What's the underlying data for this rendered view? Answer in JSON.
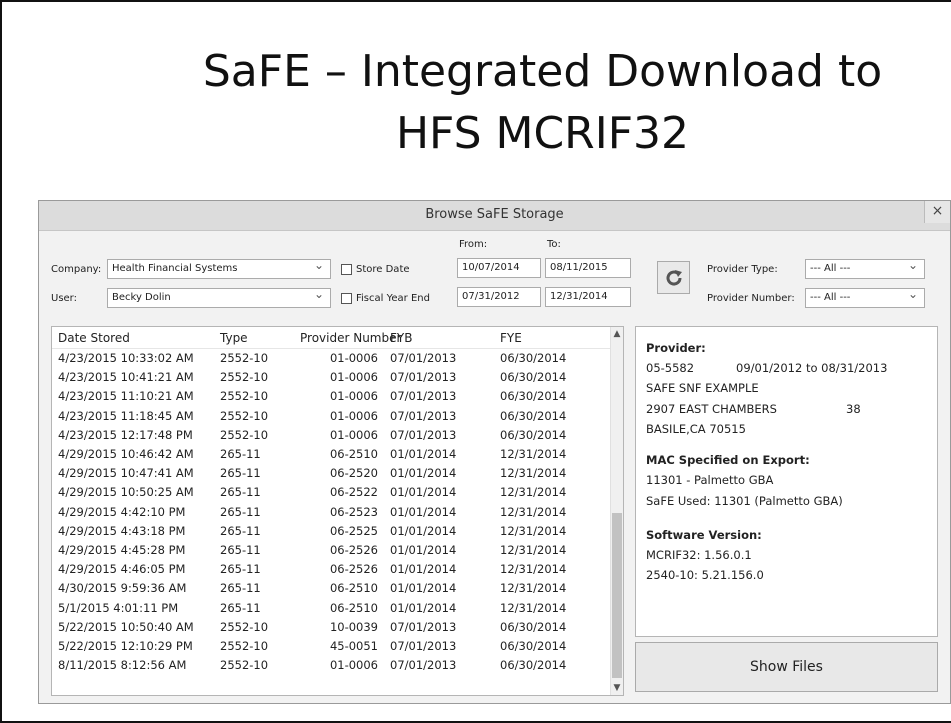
{
  "slide": {
    "title_line1": "SaFE – Integrated Download to",
    "title_line2": "HFS MCRIF32"
  },
  "window": {
    "title": "Browse SaFE Storage",
    "close_glyph": "×"
  },
  "filters": {
    "company_label": "Company:",
    "company_value": "Health Financial Systems",
    "user_label": "User:",
    "user_value": "Becky Dolin",
    "store_date_label": "Store Date",
    "fiscal_year_end_label": "Fiscal Year End",
    "from_label": "From:",
    "to_label": "To:",
    "store_from": "10/07/2014",
    "store_to": "08/11/2015",
    "fiscal_from": "07/31/2012",
    "fiscal_to": "12/31/2014",
    "provider_type_label": "Provider Type:",
    "provider_type_value": "--- All ---",
    "provider_number_label": "Provider Number:",
    "provider_number_value": "--- All ---"
  },
  "list": {
    "headers": [
      "Date Stored",
      "Type",
      "Provider Number",
      "FYB",
      "FYE"
    ],
    "rows": [
      [
        "4/23/2015 10:33:02 AM",
        "2552-10",
        "01-0006",
        "07/01/2013",
        "06/30/2014"
      ],
      [
        "4/23/2015 10:41:21 AM",
        "2552-10",
        "01-0006",
        "07/01/2013",
        "06/30/2014"
      ],
      [
        "4/23/2015 11:10:21 AM",
        "2552-10",
        "01-0006",
        "07/01/2013",
        "06/30/2014"
      ],
      [
        "4/23/2015 11:18:45 AM",
        "2552-10",
        "01-0006",
        "07/01/2013",
        "06/30/2014"
      ],
      [
        "4/23/2015 12:17:48 PM",
        "2552-10",
        "01-0006",
        "07/01/2013",
        "06/30/2014"
      ],
      [
        "4/29/2015 10:46:42 AM",
        "265-11",
        "06-2510",
        "01/01/2014",
        "12/31/2014"
      ],
      [
        "4/29/2015 10:47:41 AM",
        "265-11",
        "06-2520",
        "01/01/2014",
        "12/31/2014"
      ],
      [
        "4/29/2015 10:50:25 AM",
        "265-11",
        "06-2522",
        "01/01/2014",
        "12/31/2014"
      ],
      [
        "4/29/2015 4:42:10 PM",
        "265-11",
        "06-2523",
        "01/01/2014",
        "12/31/2014"
      ],
      [
        "4/29/2015 4:43:18 PM",
        "265-11",
        "06-2525",
        "01/01/2014",
        "12/31/2014"
      ],
      [
        "4/29/2015 4:45:28 PM",
        "265-11",
        "06-2526",
        "01/01/2014",
        "12/31/2014"
      ],
      [
        "4/29/2015 4:46:05 PM",
        "265-11",
        "06-2526",
        "01/01/2014",
        "12/31/2014"
      ],
      [
        "4/30/2015 9:59:36 AM",
        "265-11",
        "06-2510",
        "01/01/2014",
        "12/31/2014"
      ],
      [
        "5/1/2015 4:01:11 PM",
        "265-11",
        "06-2510",
        "01/01/2014",
        "12/31/2014"
      ],
      [
        "5/22/2015 10:50:40 AM",
        "2552-10",
        "10-0039",
        "07/01/2013",
        "06/30/2014"
      ],
      [
        "5/22/2015 12:10:29 PM",
        "2552-10",
        "45-0051",
        "07/01/2013",
        "06/30/2014"
      ],
      [
        "8/11/2015 8:12:56 AM",
        "2552-10",
        "01-0006",
        "07/01/2013",
        "06/30/2014"
      ]
    ]
  },
  "details": {
    "provider_heading": "Provider:",
    "provider_number": "05-5582",
    "provider_period": "09/01/2012 to 08/31/2013",
    "provider_name": "SAFE SNF EXAMPLE",
    "provider_street": "2907 EAST CHAMBERS",
    "provider_street_code": "38",
    "provider_city": "BASILE,CA 70515",
    "mac_heading": "MAC Specified on Export:",
    "mac_value": "11301 - Palmetto GBA",
    "safe_used": "SaFE Used: 11301 (Palmetto GBA)",
    "software_heading": "Software Version:",
    "mcrif_version": "MCRIF32: 1.56.0.1",
    "form_version": "2540-10: 5.21.156.0"
  },
  "show_files_label": "Show Files",
  "icons": {
    "refresh": "refresh-icon",
    "dropdown": "chevron-down-icon",
    "close": "close-icon"
  }
}
